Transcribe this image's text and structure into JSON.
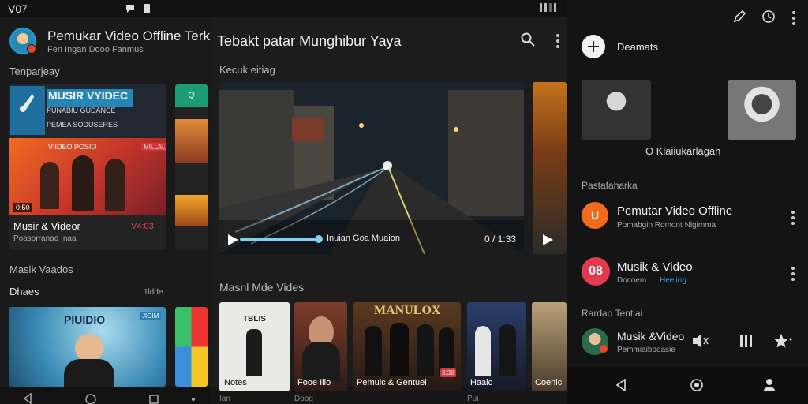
{
  "status": {
    "clock": "V07"
  },
  "left": {
    "app_title": "Pemukar Video Offline Terk",
    "app_subtitle": "Fen Ingan Dooo Fanmus",
    "section1": "Tenparjeay",
    "card1": {
      "banner_title": "MUSIR VYIDEC",
      "banner_sub": "PUNABIU GUDANCE",
      "banner_line": "PEMEA SODUSERES",
      "poster_text": "VIIDEO POSIO",
      "poster_badge": "MILLAL",
      "time": "0:50",
      "title": "Musir & Videor",
      "subtitle": "Poasorranad Inaa",
      "duration": "V4:03"
    },
    "card_small_btn": "Q",
    "section2": "Masik Vaados",
    "subheading": "Dhaes",
    "subheading_right": "1ldde",
    "card2": {
      "poster_text": "PIUIDIO",
      "badge": "JIOIM"
    }
  },
  "center": {
    "header_title": "Tebakt patar Munghibur Yaya",
    "section1": "Kecuk eitiag",
    "hero": {
      "caption": "Inuian Goa Muaion",
      "time": "0 / 1:33"
    },
    "section2": "Masnl Mde Vides",
    "posters": [
      {
        "title": "Notes",
        "top_text": "TBLIS"
      },
      {
        "title": "Fooe Ilio",
        "top_text": ""
      },
      {
        "title": "Pemuic & Gentuel",
        "top_text": "MANULOX",
        "badge": "3:38"
      },
      {
        "title": "Haaic",
        "top_text": ""
      },
      {
        "title": "Coenic",
        "top_text": ""
      }
    ],
    "footer": {
      "a": "Ian",
      "b": "Doog",
      "c": "Pui"
    }
  },
  "right": {
    "header_action": "Deamats",
    "profile_caption": "O Klaiiukarlagan",
    "section1": "Pastafaharka",
    "items": [
      {
        "title": "Pemutar Video Offline",
        "subtitle": "Pomabgin Romont Nlgimma",
        "icon_text": "U",
        "icon_color": "#f26a1b"
      },
      {
        "title": "Musik & Video",
        "subtitle": "Docoem",
        "subtitle_accent": "Heeling",
        "icon_text": "08",
        "icon_color": "#e23a4e"
      }
    ],
    "section2": "Rardao Tentlai",
    "now_playing": {
      "title": "Musik &Video",
      "subtitle": "Pemmiaibooasie"
    }
  },
  "colors": {
    "accent": "#7bd3f0",
    "orange": "#f26a1b",
    "red": "#e23a4e"
  }
}
